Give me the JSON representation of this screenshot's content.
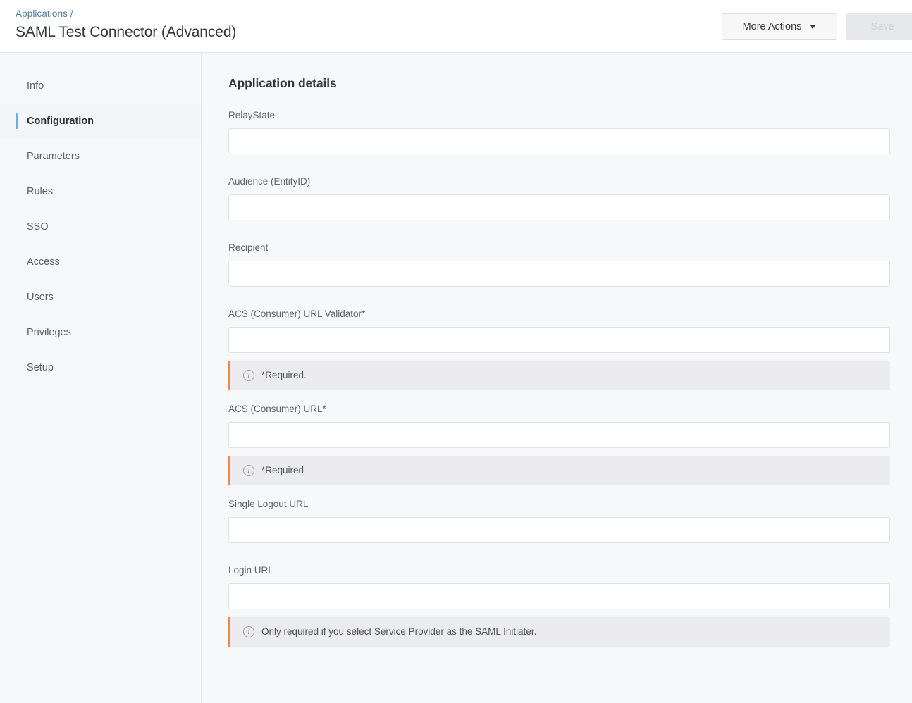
{
  "header": {
    "breadcrumb": "Applications /",
    "title": "SAML Test Connector (Advanced)",
    "more_actions_label": "More Actions",
    "save_label": "Save",
    "save_disabled": true,
    "caret_icon": "chevron-down-icon"
  },
  "sidebar": {
    "items": [
      {
        "label": "Info",
        "active": false
      },
      {
        "label": "Configuration",
        "active": true
      },
      {
        "label": "Parameters",
        "active": false
      },
      {
        "label": "Rules",
        "active": false
      },
      {
        "label": "SSO",
        "active": false
      },
      {
        "label": "Access",
        "active": false
      },
      {
        "label": "Users",
        "active": false
      },
      {
        "label": "Privileges",
        "active": false
      },
      {
        "label": "Setup",
        "active": false
      }
    ]
  },
  "main": {
    "section_title": "Application details",
    "fields": [
      {
        "label": "RelayState",
        "value": "",
        "placeholder": "",
        "hint": null
      },
      {
        "label": "Audience (EntityID)",
        "value": "",
        "placeholder": "",
        "hint": null
      },
      {
        "label": "Recipient",
        "value": "",
        "placeholder": "",
        "hint": null
      },
      {
        "label": "ACS (Consumer) URL Validator*",
        "value": "",
        "placeholder": "",
        "hint": "*Required."
      },
      {
        "label": "ACS (Consumer) URL*",
        "value": "",
        "placeholder": "",
        "hint": "*Required"
      },
      {
        "label": "Single Logout URL",
        "value": "",
        "placeholder": "",
        "hint": null
      },
      {
        "label": "Login URL",
        "value": "",
        "placeholder": "",
        "hint": "Only required if you select Service Provider as the SAML Initiater."
      }
    ],
    "info_icon": "info-circle-icon"
  },
  "colors": {
    "accent_blue": "#63b3e8",
    "breadcrumb_link": "#4c7fa3",
    "hint_accent_orange": "#f08a4b",
    "hint_background": "#ececee",
    "page_background": "#f7f8f9",
    "header_background": "#ffffff",
    "save_disabled_bg": "#e6e8e9"
  }
}
